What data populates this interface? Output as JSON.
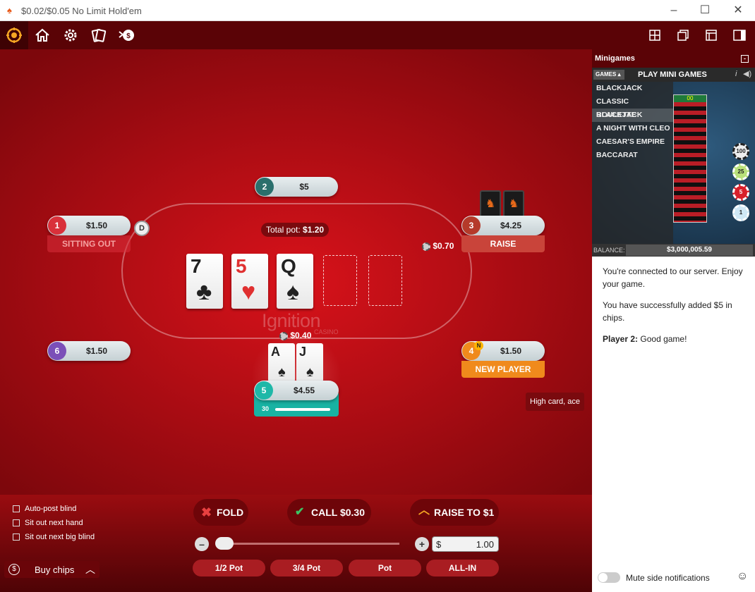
{
  "window": {
    "title": "$0.02/$0.05 No Limit Hold'em",
    "controls": [
      "minimize",
      "maximize",
      "close"
    ]
  },
  "toolbar": {
    "left_icons": [
      "lobby-icon",
      "home-icon",
      "settings-icon",
      "cards-icon",
      "tip-dealer-icon"
    ],
    "right_icons": [
      "tile-view-icon",
      "cascade-view-icon",
      "window-view-icon",
      "side-panel-icon"
    ]
  },
  "table": {
    "pot_label": "Total pot:",
    "pot_value": "$1.20",
    "brand": "Ignition",
    "brand_sub": "CASINO",
    "dealer_button": "D",
    "community_cards": [
      {
        "rank": "7",
        "suit": "♣",
        "color": "#222"
      },
      {
        "rank": "5",
        "suit": "♥",
        "color": "#e03030"
      },
      {
        "rank": "Q",
        "suit": "♠",
        "color": "#222"
      }
    ],
    "seats": [
      {
        "num": "1",
        "amount": "$1.50",
        "label": "SITTING OUT",
        "color": "#d9303a"
      },
      {
        "num": "2",
        "amount": "$5",
        "label": "",
        "color": "#2a6f6c"
      },
      {
        "num": "3",
        "amount": "$4.25",
        "label": "RAISE",
        "color": "#b53a2a"
      },
      {
        "num": "4",
        "amount": "$1.50",
        "label": "NEW PLAYER",
        "color": "#f08a1c",
        "badge": "N"
      },
      {
        "num": "5",
        "amount": "$4.55",
        "label": "",
        "color": "#1fb8a8",
        "timer": "30"
      },
      {
        "num": "6",
        "amount": "$1.50",
        "label": "",
        "color": "#7b4fb8"
      }
    ],
    "bets": {
      "seat3": "$0.70",
      "seat5": "$0.40"
    },
    "hero_cards": [
      {
        "rank": "A",
        "suit": "♠"
      },
      {
        "rank": "J",
        "suit": "♠"
      }
    ],
    "hand_strength": "High card, ace"
  },
  "controls": {
    "checkboxes": [
      "Auto-post blind",
      "Sit out next hand",
      "Sit out next big blind"
    ],
    "buy_chips": "Buy chips",
    "fold": "FOLD",
    "call": "CALL $0.30",
    "raise": "RAISE TO $1",
    "currency": "$",
    "raise_amount": "1.00",
    "presets": [
      "1/2 Pot",
      "3/4 Pot",
      "Pot",
      "ALL-IN"
    ]
  },
  "side_panel": {
    "title": "Minigames",
    "games_tab": "GAMES",
    "play_label": "PLAY MINI GAMES",
    "games": [
      "BLACKJACK",
      "CLASSIC BLACKJACK",
      "ROULETTE",
      "A NIGHT WITH CLEO",
      "CAESAR'S EMPIRE",
      "BACCARAT"
    ],
    "balance_label": "BALANCE:",
    "balance_value": "$3,000,005.59",
    "chips": [
      "100",
      "25",
      "5",
      "1"
    ],
    "messages": [
      {
        "text": "You're connected to our server. Enjoy your game."
      },
      {
        "text": "You have successfully added $5 in chips."
      },
      {
        "speaker": "Player 2:",
        "text": "Good game!"
      }
    ],
    "mute_label": "Mute side notifications"
  }
}
